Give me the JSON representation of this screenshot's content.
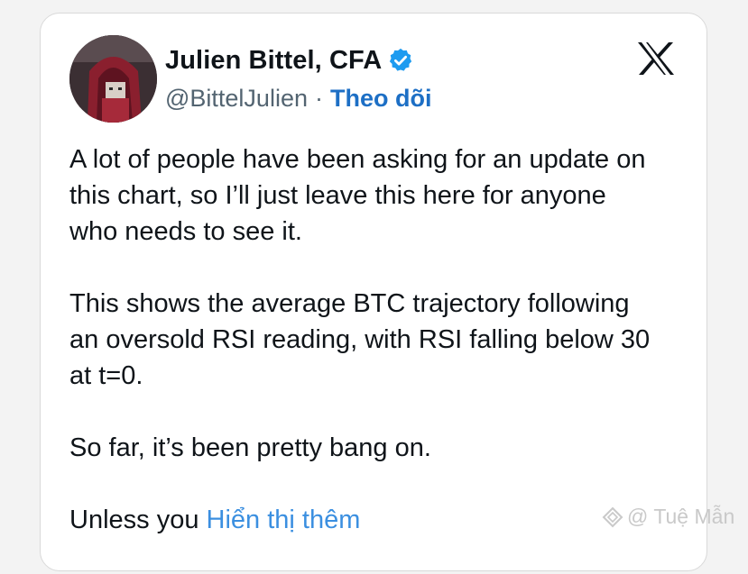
{
  "author": {
    "display_name": "Julien Bittel, CFA",
    "handle": "@BittelJulien",
    "separator": "·",
    "follow_label": "Theo dõi",
    "verified_icon": "verified-badge-icon"
  },
  "platform_icon": "x-logo-icon",
  "tweet": {
    "paragraphs": [
      "A lot of people have been asking for an update on\nthis chart, so I’ll just leave this here for anyone\nwho needs to see it.",
      "This shows the average BTC trajectory following\nan oversold RSI reading, with RSI falling below 30\nat t=0.",
      "So far, it’s been pretty bang on."
    ],
    "last_line_prefix": "Unless you ",
    "show_more_label": "Hiển thị thêm"
  },
  "watermark": {
    "text": "@ Tuệ Mẫn",
    "icon": "diamond-logo-icon"
  },
  "colors": {
    "text": "#0f1419",
    "muted": "#536471",
    "follow": "#1d6fc5",
    "link": "#3b8fe0",
    "verified": "#1d9bf0"
  }
}
